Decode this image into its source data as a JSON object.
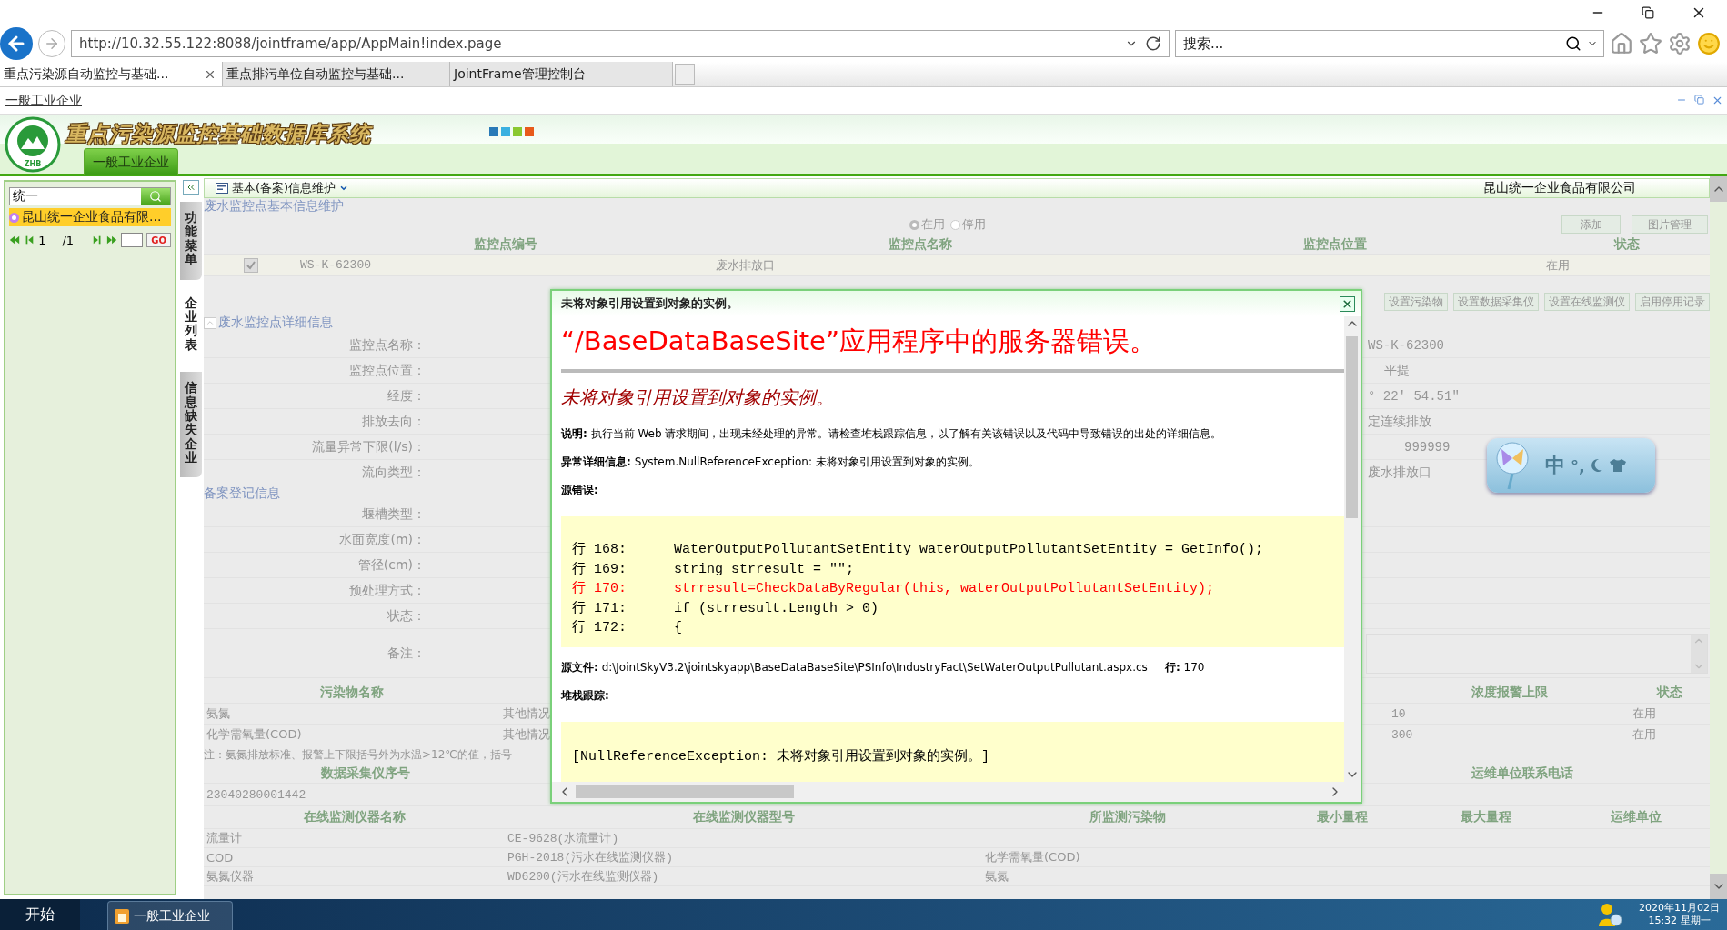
{
  "browser": {
    "address": "http://10.32.55.122:8088/jointframe/app/AppMain!index.page",
    "search_placeholder": "搜索...",
    "tabs": [
      {
        "title": "重点污染源自动监控与基础...",
        "selected": true
      },
      {
        "title": "重点排污单位自动监控与基础...",
        "selected": false
      },
      {
        "title": "JointFrame管理控制台",
        "selected": false
      }
    ]
  },
  "page_title": "一般工业企业",
  "header": {
    "logo_text": "ZHB",
    "system_title": "重点污染源监控基础数据库系统",
    "tabs": [
      {
        "label": "一般工业企业",
        "selected": true
      }
    ]
  },
  "sidebar": {
    "search_value": "统一",
    "items": [
      {
        "label": "昆山统一企业食品有限...",
        "selected": true
      }
    ],
    "pager": {
      "page": "1",
      "total": "/1",
      "go": "GO"
    }
  },
  "side_tabs": [
    {
      "label": "功能菜单",
      "selected": false
    },
    {
      "label": "企业列表",
      "selected": true
    },
    {
      "label": "信息缺失企业",
      "selected": false
    }
  ],
  "toolbar": {
    "menu": "基本(备案)信息维护",
    "company": "昆山统一企业食品有限公司"
  },
  "site_section": {
    "title": "废水监控点基本信息维护",
    "status_options": [
      {
        "label": "在用",
        "selected": true
      },
      {
        "label": "停用",
        "selected": false
      }
    ],
    "buttons": [
      "添加",
      "图片管理"
    ],
    "columns": [
      "监控点编号",
      "监控点名称",
      "监控点位置",
      "状态"
    ],
    "rows": [
      {
        "checked": true,
        "code": "WS-K-62300",
        "name": "废水排放口",
        "status": "在用"
      }
    ],
    "action_buttons": [
      "设置污染物",
      "设置数据采集仪",
      "设置在线监测仪",
      "启用停用记录"
    ]
  },
  "detail_section": {
    "title": "废水监控点详细信息",
    "expanded": true,
    "fields": [
      {
        "label": "监控点名称：",
        "value": "WS-K-62300"
      },
      {
        "label": "监控点位置：",
        "value": "平提"
      },
      {
        "label": "经度：",
        "value": "° 22′ 54.51″"
      },
      {
        "label": "排放去向：",
        "value": "定连续排放"
      },
      {
        "label": "流量异常下限(l/s)：",
        "value": "999999"
      },
      {
        "label": "流向类型：",
        "value": "废水排放口"
      }
    ]
  },
  "record_section": {
    "title": "备案登记信息",
    "fields": [
      {
        "label": "堰槽类型：",
        "kind": "text"
      },
      {
        "label": "水面宽度(m)：",
        "kind": "text"
      },
      {
        "label": "管径(cm)：",
        "kind": "text"
      },
      {
        "label": "预处理方式：",
        "kind": "text"
      },
      {
        "label": "状态：",
        "kind": "text"
      },
      {
        "label": "备注：",
        "kind": "textarea"
      }
    ]
  },
  "pollutants": {
    "columns": [
      "污染物名称",
      "浓度报警上限",
      "状态"
    ],
    "rows": [
      {
        "name": "氨氮",
        "standard": "其他情况",
        "alarm_upper": "10",
        "status": "在用"
      },
      {
        "name": "化学需氧量(COD)",
        "standard": "其他情况",
        "alarm_upper": "300",
        "status": "在用"
      }
    ],
    "note": "注：氨氮排放标准、报警上下限括号外为水温>12℃的值，括号"
  },
  "collectors": {
    "columns": [
      "数据采集仪序号",
      "运维单位联系电话"
    ],
    "rows": [
      {
        "serial": "23040280001442"
      }
    ]
  },
  "instruments": {
    "columns": [
      "在线监测仪器名称",
      "在线监测仪器型号",
      "所监测污染物",
      "最小量程",
      "最大量程",
      "运维单位"
    ],
    "rows": [
      {
        "name": "流量计",
        "model": "CE-9628(水流量计)"
      },
      {
        "name": "COD",
        "model": "PGH-2018(污水在线监测仪器)",
        "pollutant": "化学需氧量(COD)"
      },
      {
        "name": "氨氮仪器",
        "model": "WD6200(污水在线监测仪器)",
        "pollutant": "氨氮"
      }
    ]
  },
  "error_dialog": {
    "title": "未将对象引用设置到对象的实例。",
    "heading": "“/BaseDataBaseSite”应用程序中的服务器错误。",
    "message": "未将对象引用设置到对象的实例。",
    "description": "**说明:** 执行当前 Web 请求期间，出现未经处理的异常。请检查堆栈跟踪信息，以了解有关该错误以及代码中导致错误的出处的详细信息。",
    "exception_details": "**异常详细信息:** System.NullReferenceException: 未将对象引用设置到对象的实例。",
    "source_error_label": "源错误:",
    "code_lines": [
      {
        "number": "行 168:",
        "code": "WaterOutputPollutantSetEntity waterOutputPollutantSetEntity = GetInfo();",
        "error": false
      },
      {
        "number": "行 169:",
        "code": "string strresult = \"\";",
        "error": false
      },
      {
        "number": "行 170:",
        "code": "strresult=CheckDataByRegular(this, waterOutputPollutantSetEntity);",
        "error": true
      },
      {
        "number": "行 171:",
        "code": "if (strresult.Length > 0)",
        "error": false
      },
      {
        "number": "行 172:",
        "code": "{",
        "error": false
      }
    ],
    "source_file": "**源文件:** d:\\JointSkyV3.2\\jointskyapp\\BaseDataBaseSite\\PSInfo\\IndustryFact\\SetWaterOutputPullutant.aspx.cs     **行:** 170",
    "stack_label": "堆栈跟踪:",
    "stack_lines": [
      "[NullReferenceException: 未将对象引用设置到对象的实例。]"
    ]
  },
  "ime": {
    "mode": "中",
    "punctuation": "°,"
  },
  "taskbar": {
    "start": "开始",
    "tasks": [
      {
        "label": "一般工业企业",
        "selected": true
      }
    ],
    "date": "2020年11月02日",
    "time": "15:32 星期一"
  }
}
